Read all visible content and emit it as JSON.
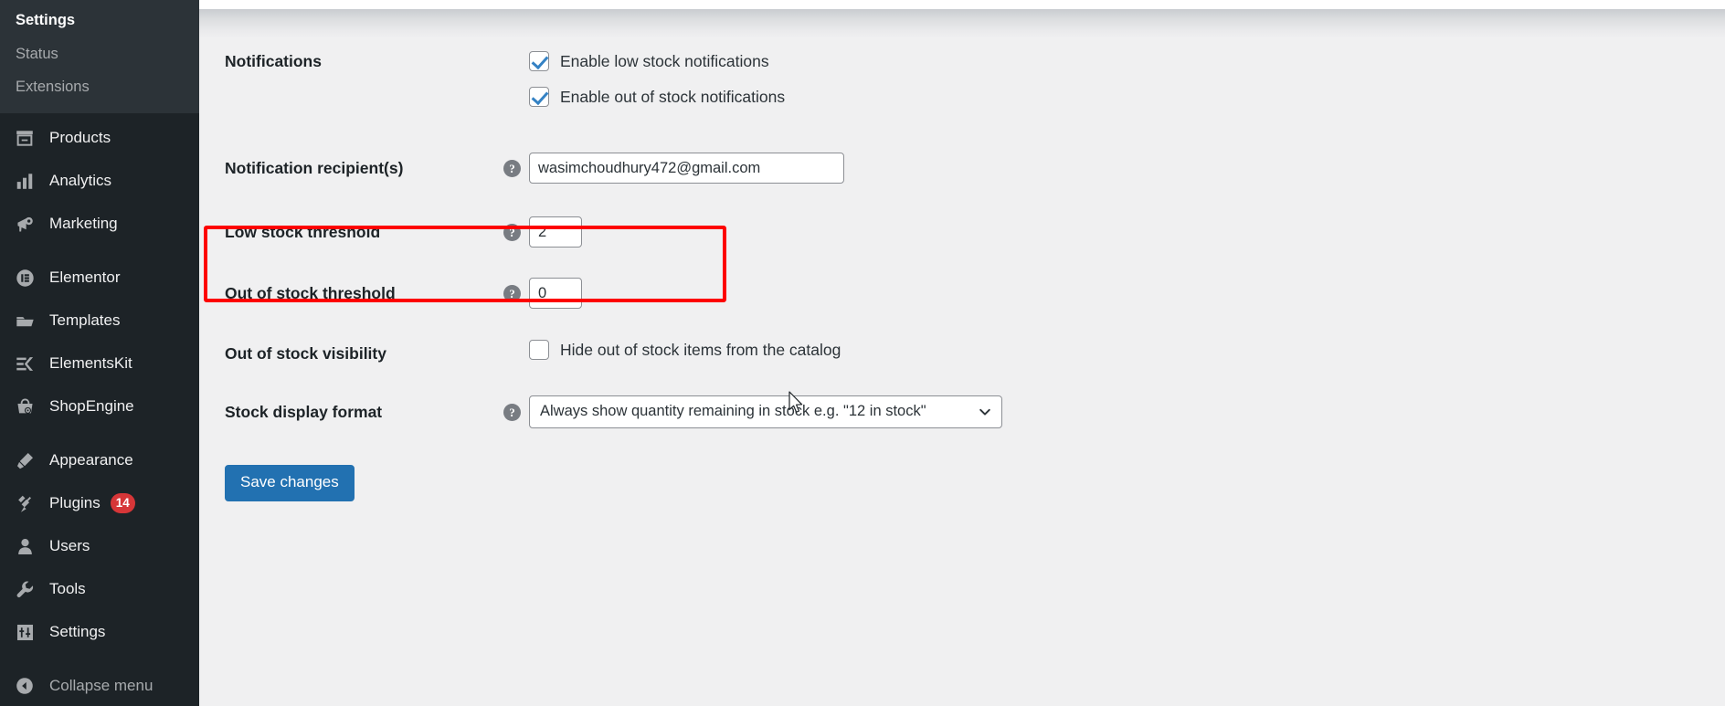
{
  "sidebar": {
    "submenu": [
      {
        "label": "Settings",
        "current": true,
        "name": "sidebar-subitem-settings"
      },
      {
        "label": "Status",
        "current": false,
        "name": "sidebar-subitem-status"
      },
      {
        "label": "Extensions",
        "current": false,
        "name": "sidebar-subitem-extensions"
      }
    ],
    "menu": [
      {
        "label": "Products",
        "icon": "products-icon",
        "name": "sidebar-item-products",
        "badge": ""
      },
      {
        "label": "Analytics",
        "icon": "analytics-icon",
        "name": "sidebar-item-analytics",
        "badge": ""
      },
      {
        "label": "Marketing",
        "icon": "marketing-icon",
        "name": "sidebar-item-marketing",
        "badge": ""
      },
      {
        "label": "Elementor",
        "icon": "elementor-icon",
        "name": "sidebar-item-elementor",
        "badge": ""
      },
      {
        "label": "Templates",
        "icon": "templates-icon",
        "name": "sidebar-item-templates",
        "badge": ""
      },
      {
        "label": "ElementsKit",
        "icon": "elementskit-icon",
        "name": "sidebar-item-elementskit",
        "badge": ""
      },
      {
        "label": "ShopEngine",
        "icon": "shopengine-icon",
        "name": "sidebar-item-shopengine",
        "badge": ""
      },
      {
        "label": "Appearance",
        "icon": "appearance-icon",
        "name": "sidebar-item-appearance",
        "badge": ""
      },
      {
        "label": "Plugins",
        "icon": "plugins-icon",
        "name": "sidebar-item-plugins",
        "badge": "14"
      },
      {
        "label": "Users",
        "icon": "users-icon",
        "name": "sidebar-item-users",
        "badge": ""
      },
      {
        "label": "Tools",
        "icon": "tools-icon",
        "name": "sidebar-item-tools",
        "badge": ""
      },
      {
        "label": "Settings",
        "icon": "settings-icon",
        "name": "sidebar-item-settings",
        "badge": ""
      }
    ],
    "collapse_label": "Collapse menu",
    "collapse_icon": "collapse-arrow-icon",
    "plugins_badge": "14"
  },
  "settings": {
    "notifications": {
      "label": "Notifications",
      "options": [
        {
          "label": "Enable low stock notifications",
          "checked": true
        },
        {
          "label": "Enable out of stock notifications",
          "checked": true
        }
      ]
    },
    "notification_recipients": {
      "label": "Notification recipient(s)",
      "value": "wasimchoudhury472@gmail.com",
      "placeholder": "",
      "help_icon": "help-icon"
    },
    "low_stock_threshold": {
      "label": "Low stock threshold",
      "value": "2",
      "help_icon": "help-icon",
      "highlight_color": "#fd0100"
    },
    "out_of_stock_threshold": {
      "label": "Out of stock threshold",
      "value": "0",
      "help_icon": "help-icon"
    },
    "out_of_stock_visibility": {
      "label": "Out of stock visibility",
      "option_label": "Hide out of stock items from the catalog",
      "checked": false
    },
    "stock_display_format": {
      "label": "Stock display format",
      "selected": "Always show quantity remaining in stock e.g. \"12 in stock\"",
      "help_icon": "help-icon",
      "caret_icon": "chevron-down-icon"
    },
    "save_button": {
      "label": "Save changes",
      "color": "#2271b1"
    }
  }
}
